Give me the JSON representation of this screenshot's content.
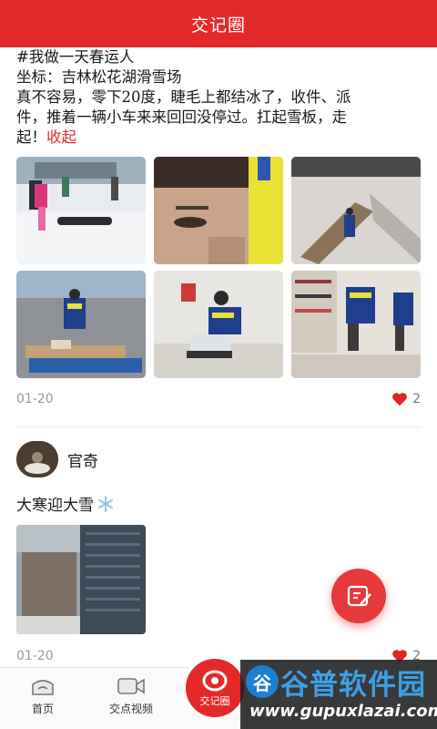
{
  "header": {
    "title": "交记圈"
  },
  "post1": {
    "lines": [
      "#我做一天春运人",
      "坐标：吉林松花湖滑雪场",
      "真不容易，零下20度，睫毛上都结冰了，收件、派",
      "件，推着一辆小车来来回回没停过。扛起雪板，走"
    ],
    "last_line": "起！",
    "collapse_label": "收起",
    "date": "01-20",
    "like_count": "2"
  },
  "post2": {
    "author": "官奇",
    "text": "大寒迎大雪",
    "date": "01-20",
    "like_count": "2"
  },
  "tabbar": {
    "home": "首页",
    "video": "交点视频",
    "circle": "交记圈"
  },
  "watermark": {
    "title": "谷普软件园",
    "url": "www.gupuxlazai.com",
    "logo": "谷"
  },
  "colors": {
    "accent": "#e4292a",
    "heart": "#e0242a",
    "muted": "#999999"
  }
}
